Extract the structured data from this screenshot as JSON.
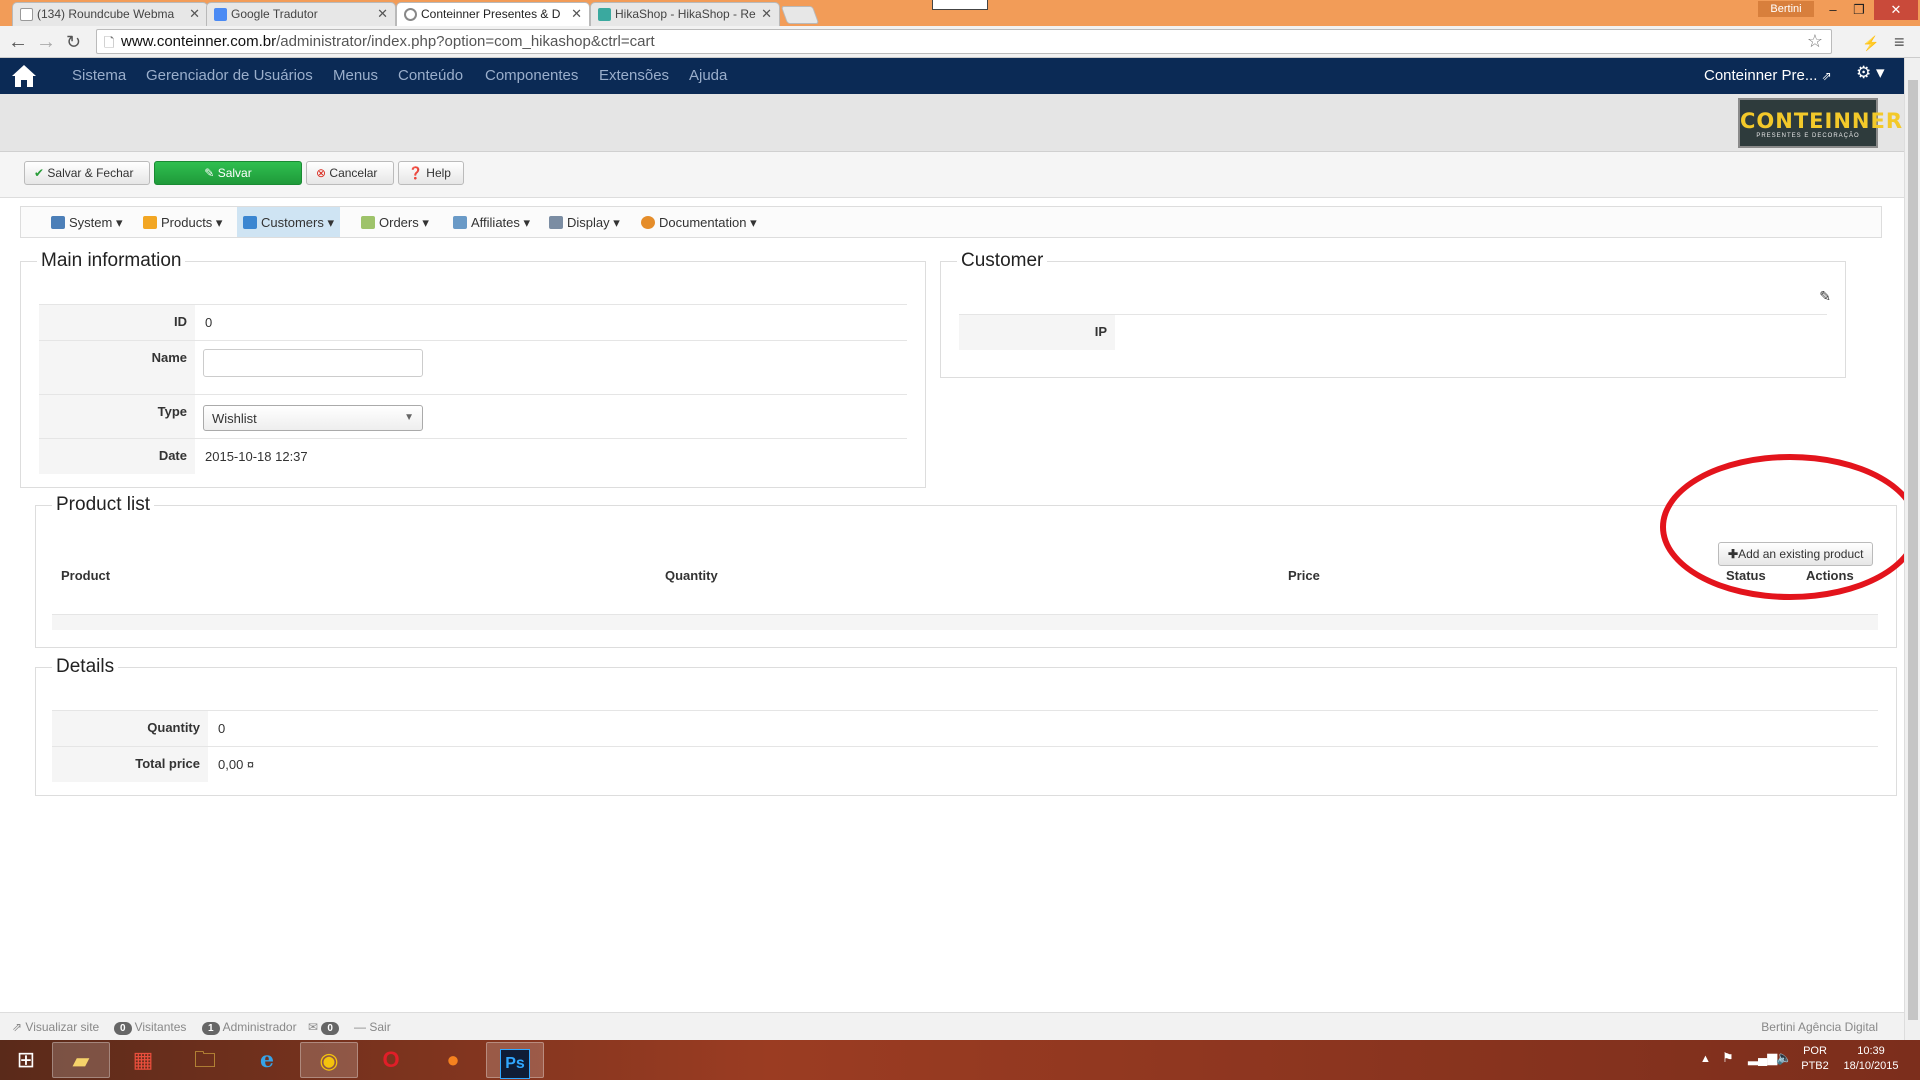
{
  "browser": {
    "tabs": [
      {
        "label": "(134) Roundcube Webma",
        "active": false
      },
      {
        "label": "Google Tradutor",
        "active": false
      },
      {
        "label": "Conteinner Presentes & D",
        "active": true
      },
      {
        "label": "HikaShop - HikaShop - Re",
        "active": false
      }
    ],
    "user_badge": "Bertini",
    "url_host": "www.conteinner.com.br",
    "url_path": "/administrator/index.php?option=com_hikashop&ctrl=cart"
  },
  "joomla_nav": {
    "items": [
      "Sistema",
      "Gerenciador de Usuários",
      "Menus",
      "Conteúdo",
      "Componentes",
      "Extensões",
      "Ajuda"
    ],
    "site_name": "Conteinner Pre..."
  },
  "logo": {
    "title": "CONTEINNER",
    "subtitle": "PRESENTES E DECORAÇÃO"
  },
  "actions": {
    "save_close": "Salvar & Fechar",
    "save": "Salvar",
    "cancel": "Cancelar",
    "help": "Help"
  },
  "hika_menu": [
    "System",
    "Products",
    "Customers",
    "Orders",
    "Affiliates",
    "Display",
    "Documentation"
  ],
  "main_info": {
    "legend": "Main information",
    "id_label": "ID",
    "id_value": "0",
    "name_label": "Name",
    "name_value": "",
    "type_label": "Type",
    "type_value": "Wishlist",
    "date_label": "Date",
    "date_value": "2015-10-18 12:37"
  },
  "customer": {
    "legend": "Customer",
    "ip_label": "IP",
    "ip_value": ""
  },
  "product_list": {
    "legend": "Product list",
    "add_button": "Add an existing product",
    "columns": [
      "Product",
      "Quantity",
      "Price",
      "Status",
      "Actions"
    ]
  },
  "details": {
    "legend": "Details",
    "quantity_label": "Quantity",
    "quantity_value": "0",
    "total_label": "Total price",
    "total_value": "0,00 ¤"
  },
  "status_bar": {
    "view_site": "Visualizar site",
    "visitors_count": "0",
    "visitors_label": "Visitantes",
    "admin_count": "1",
    "admin_label": "Administrador",
    "msg_count": "0",
    "logout": "Sair",
    "credit": "Bertini Agência Digital"
  },
  "taskbar": {
    "lang": "POR",
    "layout": "PTB2",
    "time": "10:39",
    "date": "18/10/2015"
  },
  "colors": {
    "joomla_nav": "#0b2a55",
    "accent_red": "#e3141c",
    "save_green": "#28a745"
  }
}
